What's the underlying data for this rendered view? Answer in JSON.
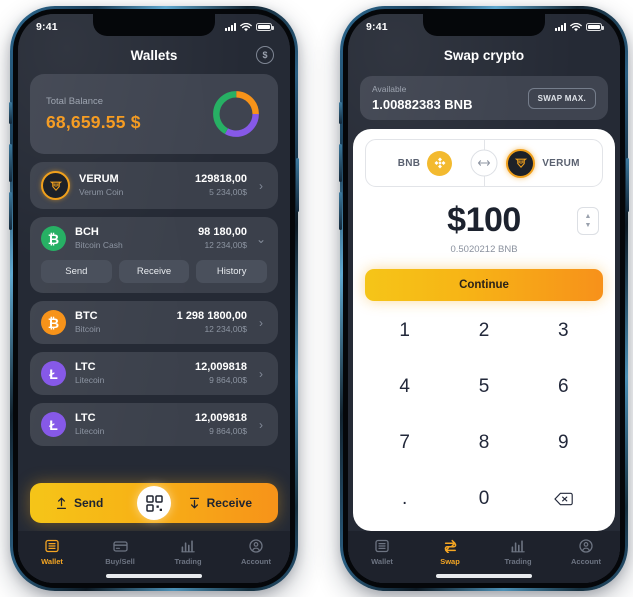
{
  "background": "#ffffff",
  "accent": "#f5a623",
  "status_bar": {
    "time": "9:41",
    "signal_icon": "signal-bars-icon",
    "wifi_icon": "wifi-icon",
    "battery_icon": "battery-icon"
  },
  "wallet_screen": {
    "title": "Wallets",
    "header_action_icon": "dollar-circle-icon",
    "balance": {
      "label": "Total Balance",
      "amount": "68,659.55",
      "currency_symbol": "$",
      "donut_segments": [
        {
          "name": "orange",
          "color": "#f79319",
          "percent": 25
        },
        {
          "name": "purple",
          "color": "#8659e8",
          "percent": 33
        },
        {
          "name": "green",
          "color": "#27b064",
          "percent": 42
        }
      ]
    },
    "coins": [
      {
        "symbol": "VERUM",
        "name": "Verum Coin",
        "amount": "129818,00",
        "fiat": "5 234,00$",
        "icon": "verum-coin-icon",
        "chevron": "chevron-right-icon",
        "expanded": false
      },
      {
        "symbol": "BCH",
        "name": "Bitcoin Cash",
        "amount": "98 180,00",
        "fiat": "12 234,00$",
        "icon": "bitcoin-cash-icon",
        "chevron": "chevron-down-icon",
        "expanded": true,
        "actions": [
          "Send",
          "Receive",
          "History"
        ]
      },
      {
        "symbol": "BTC",
        "name": "Bitcoin",
        "amount": "1 298 1800,00",
        "fiat": "12 234,00$",
        "icon": "bitcoin-icon",
        "chevron": "chevron-right-icon",
        "expanded": false
      },
      {
        "symbol": "LTC",
        "name": "Litecoin",
        "amount": "12,009818",
        "fiat": "9 864,00$",
        "icon": "litecoin-icon",
        "chevron": "chevron-right-icon",
        "expanded": false
      },
      {
        "symbol": "LTC",
        "name": "Litecoin",
        "amount": "12,009818",
        "fiat": "9 864,00$",
        "icon": "litecoin-icon",
        "chevron": "chevron-right-icon",
        "expanded": false
      }
    ],
    "cta": {
      "send_label": "Send",
      "receive_label": "Receive",
      "send_icon": "upload-arrow-icon",
      "receive_icon": "download-arrow-icon",
      "qr_icon": "qr-code-icon"
    },
    "tabs": [
      {
        "label": "Wallet",
        "icon": "wallet-list-icon",
        "active": true
      },
      {
        "label": "Buy/Sell",
        "icon": "credit-card-icon",
        "active": false
      },
      {
        "label": "Trading",
        "icon": "bar-chart-icon",
        "active": false
      },
      {
        "label": "Account",
        "icon": "account-person-icon",
        "active": false
      }
    ]
  },
  "swap_screen": {
    "title": "Swap crypto",
    "available": {
      "label": "Available",
      "value": "1.00882383 BNB",
      "max_button": "SWAP MAX."
    },
    "pair": {
      "from_label": "BNB",
      "from_icon": "binance-coin-icon",
      "to_label": "VERUM",
      "to_icon": "verum-coin-icon",
      "switch_icon": "left-right-arrows-icon"
    },
    "amount": {
      "value": "$100",
      "converted": "0.5020212 BNB",
      "stepper_icon": "stepper-up-down-icon"
    },
    "continue_label": "Continue",
    "keypad": [
      "1",
      "2",
      "3",
      "4",
      "5",
      "6",
      "7",
      "8",
      "9",
      ".",
      "0",
      "backspace-icon"
    ],
    "tabs": [
      {
        "label": "Wallet",
        "icon": "wallet-list-icon",
        "active": false
      },
      {
        "label": "Swap",
        "icon": "swap-arrows-icon",
        "active": true
      },
      {
        "label": "Trading",
        "icon": "bar-chart-icon",
        "active": false
      },
      {
        "label": "Account",
        "icon": "account-person-icon",
        "active": false
      }
    ]
  }
}
